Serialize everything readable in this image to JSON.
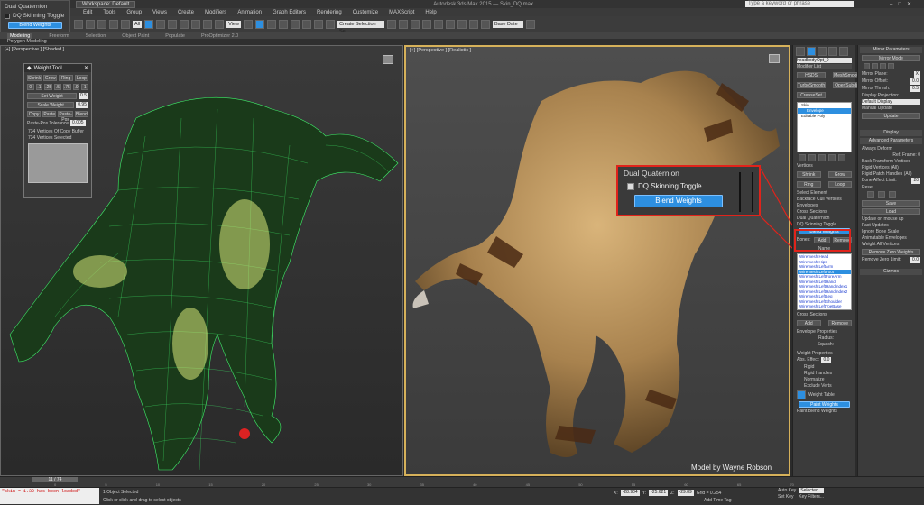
{
  "inset": {
    "title": "Dual Quaternion",
    "toggle": "DQ Skinning Toggle",
    "button": "Blend Weights"
  },
  "titlebar": {
    "workspace": "Workspace: Default",
    "title": "Autodesk 3ds Max 2015 — Skin_DQ.max",
    "search": "Type a keyword or phrase"
  },
  "menus": [
    "Edit",
    "Tools",
    "Group",
    "Views",
    "Create",
    "Modifiers",
    "Animation",
    "Graph Editors",
    "Rendering",
    "Customize",
    "MAXScript",
    "Help"
  ],
  "toolbar": {
    "filter": "All",
    "view": "View",
    "selection_set": "Create Selection Se",
    "snap": "Base Date"
  },
  "ribbon": {
    "tabs": [
      "Modeling",
      "Freeform",
      "Selection",
      "Object Paint",
      "Populate",
      "ProOptimizer 2.0"
    ],
    "sub": "Polygon Modeling"
  },
  "viewports": {
    "left_label": "[+] [Perspective ] [Shaded ]",
    "right_label": "[+] [Perspective ] [Realistic ]",
    "credit": "Model by Wayne Robson"
  },
  "weight_tool": {
    "title": "Weight Tool",
    "ring": [
      "Shrink",
      "Grow",
      "Ring",
      "Loop"
    ],
    "presets": [
      "0",
      ".1",
      ".25",
      ".5",
      ".75",
      ".9",
      "1"
    ],
    "set_weight": "Set Weight",
    "set_weight_val": "0.5",
    "scale_weight": "Scale Weight",
    "scale_weight_val": "0.95",
    "ops": [
      "Copy",
      "Paste",
      "Paste-Pos",
      "Blend"
    ],
    "paste_tol": "Paste-Pos Tolerance",
    "paste_tol_val": "0.005",
    "info1": "734 Vertices Of Copy Buffer",
    "info2": "734 Vertices Selected"
  },
  "callout": {
    "title": "Dual Quaternion",
    "toggle": "DQ Skinning Toggle",
    "button": "Blend Weights"
  },
  "cmd_panel": {
    "object": "headbodyOpt_0",
    "modifier_list": "Modifier List",
    "mod_btns": [
      "HSDS",
      "MeshSmooth",
      "TurboSmooth",
      "OpenSubdiv",
      "CreaseSet"
    ],
    "stack": [
      "Skin",
      "Envelope",
      "Editable Poly"
    ],
    "sel_opts": [
      "Vertices",
      "Shrink",
      "Grow",
      "Ring",
      "Loop",
      "Select Element",
      "Backface Cull Vertices",
      "Envelopes",
      "Cross Sections"
    ],
    "dq": {
      "title": "Dual Quaternion",
      "toggle": "DQ Skinning Toggle",
      "button": "Blend Weights"
    },
    "bones_label": "Bones:",
    "bones_add": "Add",
    "bones_remove": "Remove",
    "name_label": "Name",
    "bones": [
      "Wiremesh:Head",
      "Wiremesh:Hips",
      "Wiremesh:LeftArm",
      "Wiremesh:LeftFoot",
      "Wiremesh:LeftForeArm",
      "Wiremesh:LeftHand",
      "Wiremesh:LeftHandIndex1",
      "Wiremesh:LeftHandIndex2",
      "Wiremesh:LeftLeg",
      "Wiremesh:LeftShoulder",
      "Wiremesh:LeftToeBase"
    ],
    "cross_title": "Cross Sections",
    "cross_add": "Add",
    "cross_remove": "Remove",
    "env_title": "Envelope Properties",
    "radius": "Radius:",
    "squash": "Squash:",
    "wp_title": "Weight Properties",
    "abs_effect": "Abs. Effect:",
    "abs_val": "0.0",
    "wp_opts": [
      "Rigid",
      "Rigid Handles",
      "Normalize",
      "Exclude Verts"
    ],
    "weight_table": "Weight Table",
    "paint_weights": "Paint Weights",
    "paint_blend": "Paint Blend Weights"
  },
  "panel2": {
    "mirror_title": "Mirror Parameters",
    "mirror_mode": "Mirror Mode",
    "mirror_plane": "Mirror Plane:",
    "mirror_plane_val": "X",
    "mirror_offset": "Mirror Offset:",
    "mirror_offset_val": "0.0",
    "mirror_thresh": "Mirror Thresh:",
    "mirror_thresh_val": "0.5",
    "display_proj": "Display Projection:",
    "display_val": "Default Display",
    "manual_update": "Manual Update",
    "update": "Update",
    "display_title": "Display",
    "adv_title": "Advanced Parameters",
    "adv_opts": [
      "Always Deform",
      "Ref. Frame: 0",
      "Back Transform Vertices",
      "Rigid Vertices (All)",
      "Rigid Patch Handles (All)"
    ],
    "bone_limit": "Bone Affect Limit:",
    "bone_limit_val": "20",
    "reset": "Reset",
    "save": "Save",
    "load": "Load",
    "opts2": [
      "Update on mouse up",
      "Fast Updates",
      "Ignore Bone Scale",
      "Animatable Envelopes",
      "Weight All Vertices"
    ],
    "remove_zero": "Remove Zero Weights",
    "remove_limit": "Remove Zero Limit:",
    "remove_limit_val": "0.0",
    "gizmos_title": "Gizmos"
  },
  "timeline": {
    "slider": "11 / 74",
    "ticks": [
      "0",
      "5",
      "10",
      "15",
      "20",
      "25",
      "30",
      "35",
      "40",
      "45",
      "50",
      "55",
      "60",
      "65",
      "70"
    ]
  },
  "status": {
    "script": "\"skin = 1.39 has been loaded\"",
    "selected": "1 Object Selected",
    "hint": "Click or click-and-drag to select objects",
    "x": "-28.904",
    "y": "-25.621",
    "z": "-29.89",
    "grid": "Grid = 0.254",
    "autokey": "Auto Key",
    "autokey_val": "Selected",
    "setkey": "Set Key",
    "keyfilters": "Key Filters...",
    "addtime": "Add Time Tag"
  },
  "colors": {
    "accent": "#2d8fe0",
    "callout": "#e0231b",
    "viewport_frame": "#d6b15a"
  }
}
